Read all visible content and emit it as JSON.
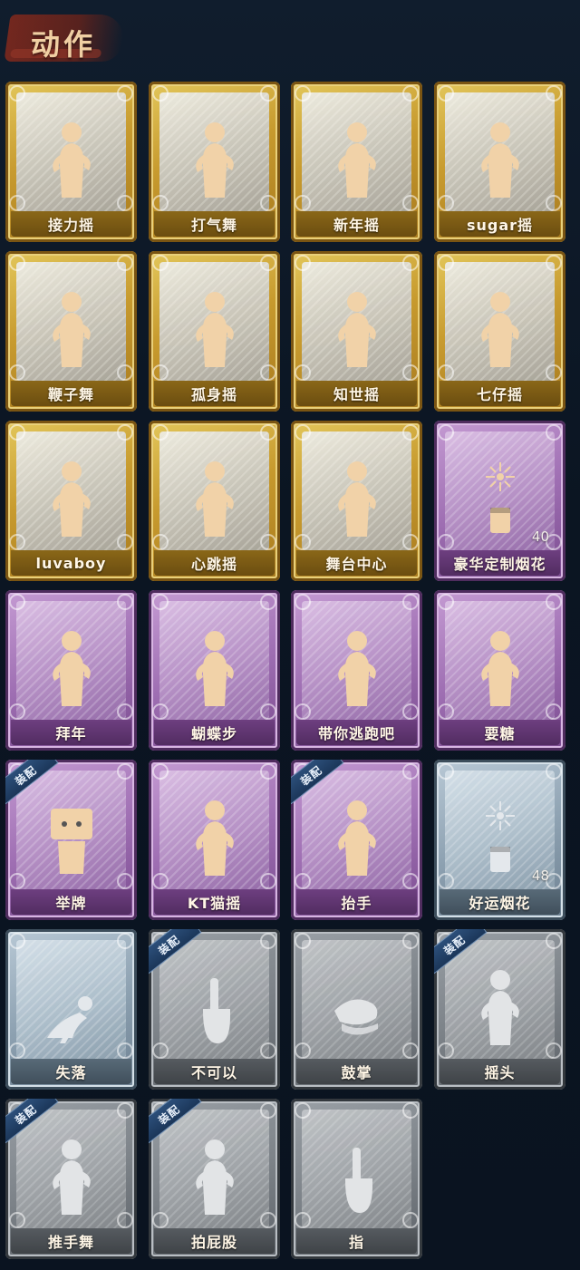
{
  "section": {
    "title": "动作"
  },
  "cards": [
    {
      "label": "接力摇",
      "tier": "gold",
      "icon": "dance-figure-icon",
      "equipped": false,
      "count": ""
    },
    {
      "label": "打气舞",
      "tier": "gold",
      "icon": "dance-figure-icon",
      "equipped": false,
      "count": ""
    },
    {
      "label": "新年摇",
      "tier": "gold",
      "icon": "dance-figure-icon",
      "equipped": false,
      "count": ""
    },
    {
      "label": "sugar摇",
      "tier": "gold",
      "icon": "dance-figure-icon",
      "equipped": false,
      "count": ""
    },
    {
      "label": "鞭子舞",
      "tier": "gold",
      "icon": "dance-figure-icon",
      "equipped": false,
      "count": ""
    },
    {
      "label": "孤身摇",
      "tier": "gold",
      "icon": "dance-figure-icon",
      "equipped": false,
      "count": ""
    },
    {
      "label": "知世摇",
      "tier": "gold",
      "icon": "dance-figure-icon",
      "equipped": false,
      "count": ""
    },
    {
      "label": "七仔摇",
      "tier": "gold",
      "icon": "dance-figure-icon",
      "equipped": false,
      "count": ""
    },
    {
      "label": "luvaboy",
      "tier": "gold",
      "icon": "dance-figure-icon",
      "equipped": false,
      "count": ""
    },
    {
      "label": "心跳摇",
      "tier": "gold",
      "icon": "dance-figure-icon",
      "equipped": false,
      "count": ""
    },
    {
      "label": "舞台中心",
      "tier": "gold",
      "icon": "dance-figure-icon",
      "equipped": false,
      "count": ""
    },
    {
      "label": "豪华定制烟花",
      "tier": "purple",
      "icon": "fireworks-icon",
      "equipped": false,
      "count": "40"
    },
    {
      "label": "拜年",
      "tier": "purple",
      "icon": "figure-icon",
      "equipped": false,
      "count": ""
    },
    {
      "label": "蝴蝶步",
      "tier": "purple",
      "icon": "dance-figure-icon",
      "equipped": false,
      "count": ""
    },
    {
      "label": "带你逃跑吧",
      "tier": "purple",
      "icon": "dance-figure-icon",
      "equipped": false,
      "count": ""
    },
    {
      "label": "要糖",
      "tier": "purple",
      "icon": "figure-icon",
      "equipped": false,
      "count": ""
    },
    {
      "label": "举牌",
      "tier": "purple",
      "icon": "sign-figure-icon",
      "equipped": true,
      "count": ""
    },
    {
      "label": "KT猫摇",
      "tier": "purple",
      "icon": "dance-figure-icon",
      "equipped": false,
      "count": ""
    },
    {
      "label": "抬手",
      "tier": "purple",
      "icon": "figure-icon",
      "equipped": true,
      "count": ""
    },
    {
      "label": "好运烟花",
      "tier": "silver",
      "icon": "fireworks-icon",
      "equipped": false,
      "count": "48"
    },
    {
      "label": "失落",
      "tier": "silver",
      "icon": "crawl-figure-icon",
      "equipped": false,
      "count": ""
    },
    {
      "label": "不可以",
      "tier": "grey",
      "icon": "finger-wag-icon",
      "equipped": true,
      "count": ""
    },
    {
      "label": "鼓掌",
      "tier": "grey",
      "icon": "clap-hands-icon",
      "equipped": false,
      "count": ""
    },
    {
      "label": "摇头",
      "tier": "grey",
      "icon": "figure-icon",
      "equipped": true,
      "count": ""
    },
    {
      "label": "推手舞",
      "tier": "grey",
      "icon": "figure-icon",
      "equipped": true,
      "count": ""
    },
    {
      "label": "拍屁股",
      "tier": "grey",
      "icon": "figure-icon",
      "equipped": true,
      "count": ""
    },
    {
      "label": "指",
      "tier": "grey",
      "icon": "point-hand-icon",
      "equipped": false,
      "count": ""
    }
  ],
  "badge_text": "装配",
  "colors": {
    "gold": "#c79a2e",
    "purple": "#9f6fb3",
    "silver": "#8ea2b2",
    "grey": "#7d8389",
    "badge": "#1b3659",
    "background": "#0d1826"
  }
}
